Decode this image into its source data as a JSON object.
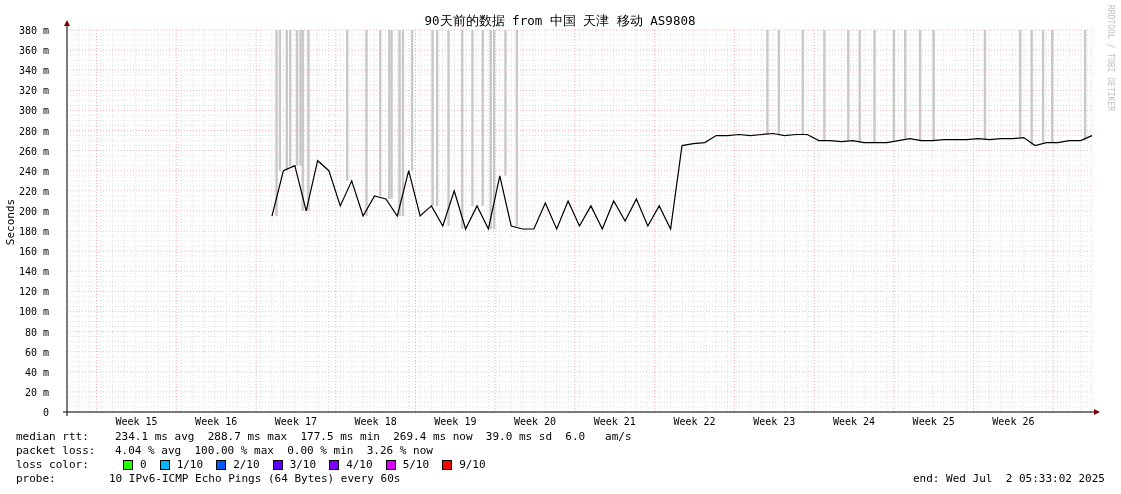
{
  "chart": {
    "chart_data": {
      "type": "line",
      "title": "90天前的数据 from 中国 天津 移动 AS9808",
      "ylabel": "Seconds",
      "ylim": [
        0,
        380
      ],
      "yticks": [
        {
          "value": 0,
          "label": "0"
        },
        {
          "value": 20,
          "label": "20 m"
        },
        {
          "value": 40,
          "label": "40 m"
        },
        {
          "value": 60,
          "label": "60 m"
        },
        {
          "value": 80,
          "label": "80 m"
        },
        {
          "value": 100,
          "label": "100 m"
        },
        {
          "value": 120,
          "label": "120 m"
        },
        {
          "value": 140,
          "label": "140 m"
        },
        {
          "value": 160,
          "label": "160 m"
        },
        {
          "value": 180,
          "label": "180 m"
        },
        {
          "value": 200,
          "label": "200 m"
        },
        {
          "value": 220,
          "label": "220 m"
        },
        {
          "value": 240,
          "label": "240 m"
        },
        {
          "value": 260,
          "label": "260 m"
        },
        {
          "value": 280,
          "label": "280 m"
        },
        {
          "value": 300,
          "label": "300 m"
        },
        {
          "value": 320,
          "label": "320 m"
        },
        {
          "value": 340,
          "label": "340 m"
        },
        {
          "value": 360,
          "label": "360 m"
        },
        {
          "value": 380,
          "label": "380 m"
        }
      ],
      "categories": [
        null,
        null,
        null,
        null,
        null,
        null,
        "Week 15",
        null,
        null,
        null,
        null,
        null,
        null,
        "Week 16",
        null,
        null,
        null,
        null,
        null,
        null,
        "Week 17",
        null,
        null,
        null,
        null,
        null,
        null,
        "Week 18",
        null,
        null,
        null,
        null,
        null,
        null,
        "Week 19",
        null,
        null,
        null,
        null,
        null,
        null,
        "Week 20",
        null,
        null,
        null,
        null,
        null,
        null,
        "Week 21",
        null,
        null,
        null,
        null,
        null,
        null,
        "Week 22",
        null,
        null,
        null,
        null,
        null,
        null,
        "Week 23",
        null,
        null,
        null,
        null,
        null,
        null,
        "Week 24",
        null,
        null,
        null,
        null,
        null,
        null,
        "Week 25",
        null,
        null,
        null,
        null,
        null,
        null,
        "Week 26",
        null,
        null,
        null,
        null,
        null,
        null,
        null
      ],
      "series": [
        {
          "color": "#000000",
          "values": [
            null,
            null,
            null,
            null,
            null,
            null,
            null,
            null,
            null,
            null,
            null,
            null,
            null,
            null,
            null,
            null,
            null,
            null,
            195,
            240,
            245,
            200,
            250,
            240,
            205,
            230,
            195,
            215,
            212,
            195,
            240,
            195,
            205,
            185,
            220,
            182,
            205,
            182,
            235,
            185,
            182,
            182,
            208,
            182,
            210,
            185,
            205,
            182,
            210,
            190,
            212,
            185,
            205,
            182,
            265,
            267,
            268,
            275,
            275,
            276,
            275,
            276,
            277,
            275,
            276,
            276,
            270,
            270,
            269,
            270,
            268,
            268,
            268,
            270,
            272,
            270,
            270,
            271,
            271,
            271,
            272,
            271,
            272,
            272,
            273,
            265,
            268,
            268,
            270,
            270,
            275
          ]
        }
      ],
      "grid": true
    },
    "credit": "RRDTOOL / TOBI OETIKER"
  },
  "legend": {
    "median_rtt": {
      "label": "median rtt:",
      "text": "234.1 ms avg  288.7 ms max  177.5 ms min  269.4 ms now  39.0 ms sd  6.0   am/s"
    },
    "packet_loss": {
      "label": "packet loss:",
      "text": "4.04 % avg  100.00 % max  0.00 % min  3.26 % now"
    },
    "loss_color": {
      "label": "loss color:",
      "items": [
        {
          "label": "0",
          "color": "#26ff00"
        },
        {
          "label": "1/10",
          "color": "#00b8ff"
        },
        {
          "label": "2/10",
          "color": "#0059ff"
        },
        {
          "label": "3/10",
          "color": "#5e00ff"
        },
        {
          "label": "4/10",
          "color": "#7e00ff"
        },
        {
          "label": "5/10",
          "color": "#dd00ff"
        },
        {
          "label": "9/10",
          "color": "#ff0000"
        }
      ]
    },
    "probe": {
      "label": "probe:",
      "text": "10 IPv6-ICMP Echo Pings (64 Bytes) every 60s"
    },
    "end": "end: Wed Jul  2 05:33:02 2025"
  }
}
